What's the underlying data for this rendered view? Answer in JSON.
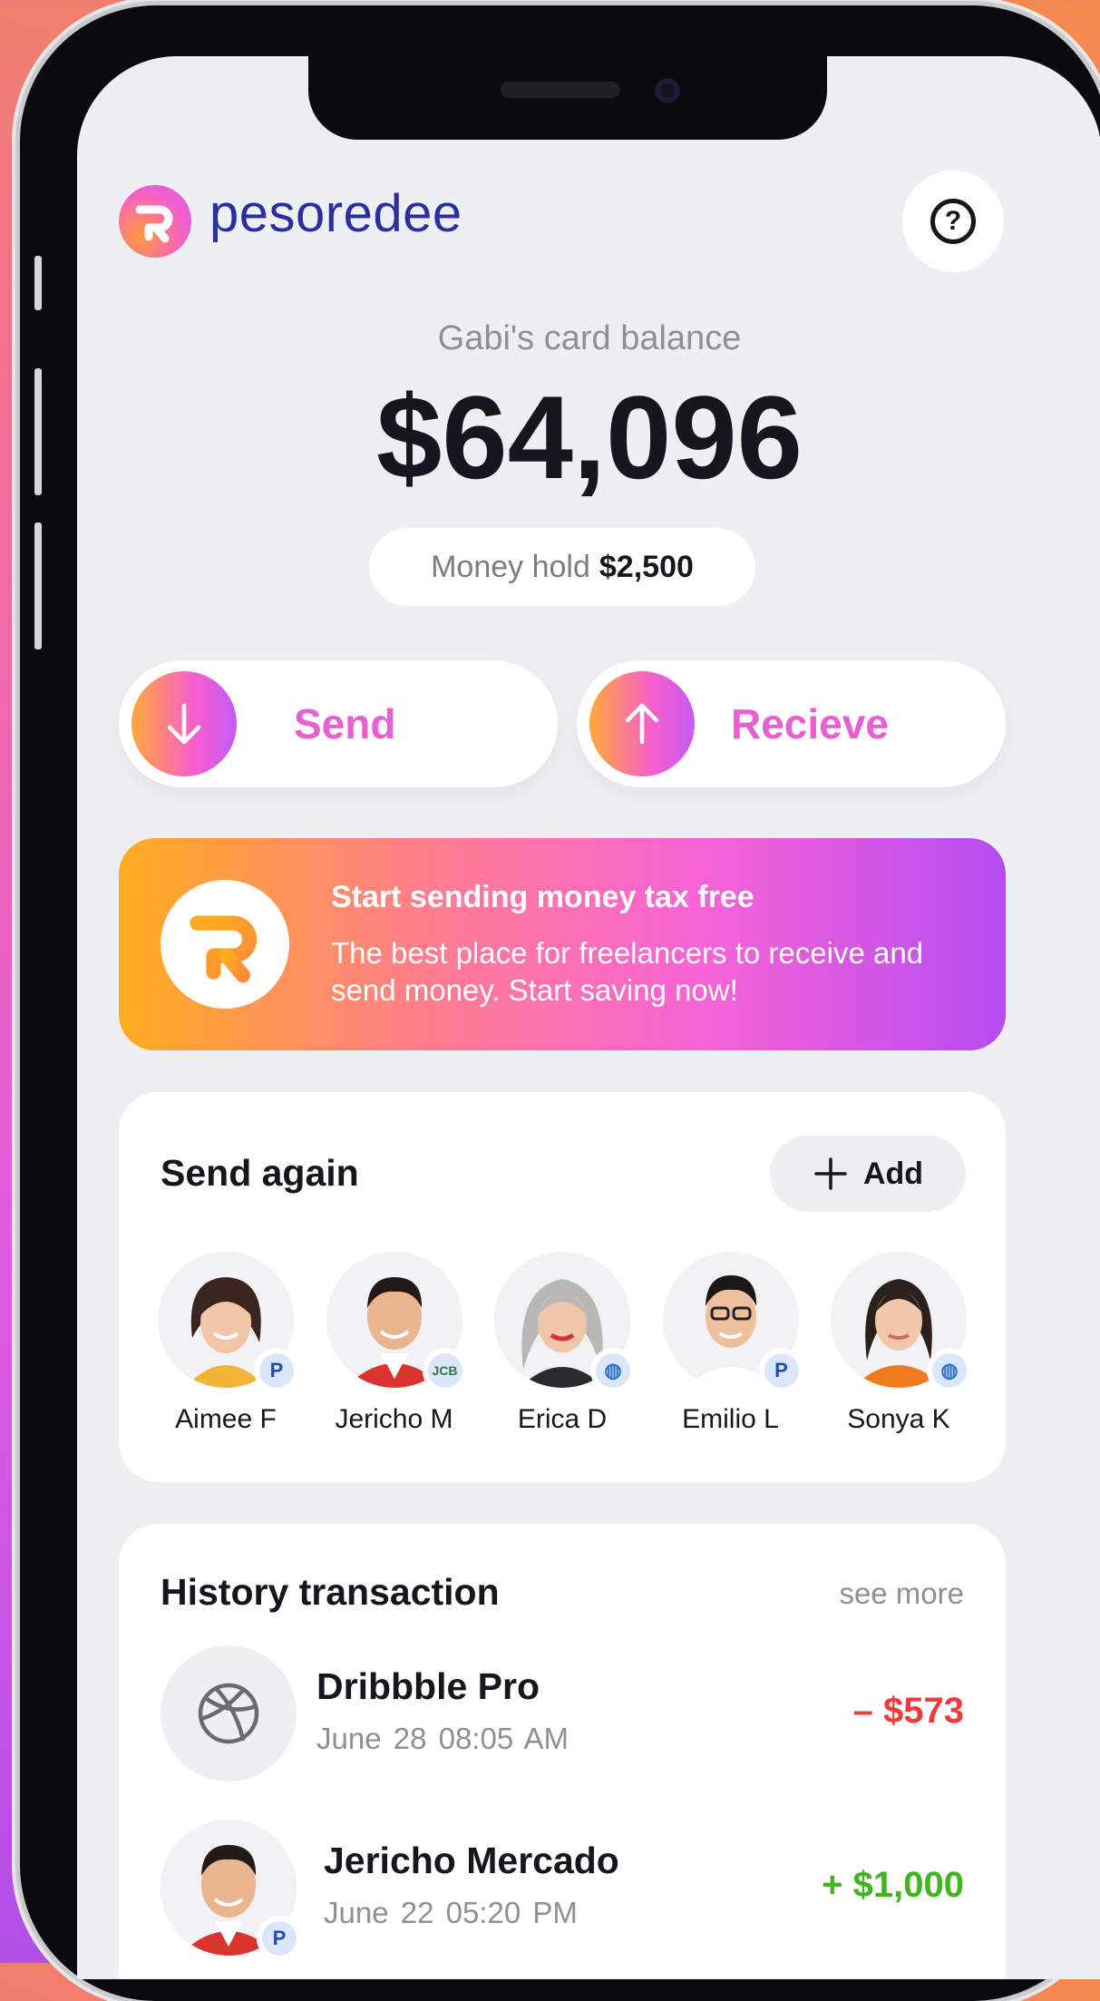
{
  "app": {
    "brand": "pesoredee",
    "help_glyph": "?",
    "colors": {
      "accent_pink": "#e95fcf",
      "accent_orange": "#ffac1e",
      "accent_purple": "#b54cf0",
      "negative": "#ef3b3b",
      "positive": "#3fb51f"
    }
  },
  "balance": {
    "label": "Gabi's card balance",
    "amount": "$64,096",
    "hold_label": "Money hold",
    "hold_value": "$2,500"
  },
  "actions": [
    {
      "label": "Send",
      "icon": "arrow-down-icon"
    },
    {
      "label": "Recieve",
      "icon": "arrow-up-icon"
    }
  ],
  "promo": {
    "title": "Start sending money tax free",
    "description": "The best place for freelancers to receive and send money. Start saving now!"
  },
  "send_again": {
    "title": "Send again",
    "add_label": "Add",
    "contacts": [
      {
        "name": "Aimee F",
        "payment": "paypal-icon"
      },
      {
        "name": "Jericho M",
        "payment": "jcb-icon"
      },
      {
        "name": "Erica D",
        "payment": "webmoney-icon"
      },
      {
        "name": "Emilio L",
        "payment": "paypal-icon"
      },
      {
        "name": "Sonya K",
        "payment": "webmoney-icon"
      }
    ]
  },
  "history": {
    "title": "History transaction",
    "see_more": "see more",
    "items": [
      {
        "title": "Dribbble Pro",
        "date": "June 28 08:05 AM",
        "amount": "– $573",
        "type": "debit",
        "icon": "dribbble-icon"
      },
      {
        "title": "Jericho Mercado",
        "date": "June 22 05:20 PM",
        "amount": "+ $1,000",
        "type": "credit",
        "icon": "avatar"
      }
    ]
  }
}
